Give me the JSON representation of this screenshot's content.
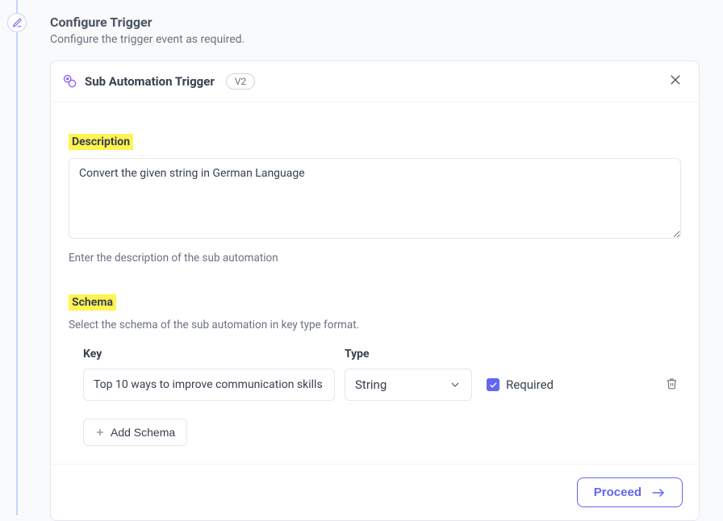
{
  "header": {
    "title": "Configure Trigger",
    "subtitle": "Configure the trigger event as required."
  },
  "card": {
    "title": "Sub Automation Trigger",
    "version": "V2"
  },
  "description": {
    "label": "Description",
    "value": "Convert the given string in German Language",
    "helper": "Enter the description of the sub automation"
  },
  "schema": {
    "label": "Schema",
    "helper": "Select the schema of the sub automation in key type format.",
    "columns": {
      "key": "Key",
      "type": "Type"
    },
    "rows": [
      {
        "key": "Top 10 ways to improve communication skills",
        "type": "String",
        "required": true
      }
    ],
    "required_label": "Required",
    "add_label": "Add Schema"
  },
  "footer": {
    "proceed": "Proceed"
  }
}
